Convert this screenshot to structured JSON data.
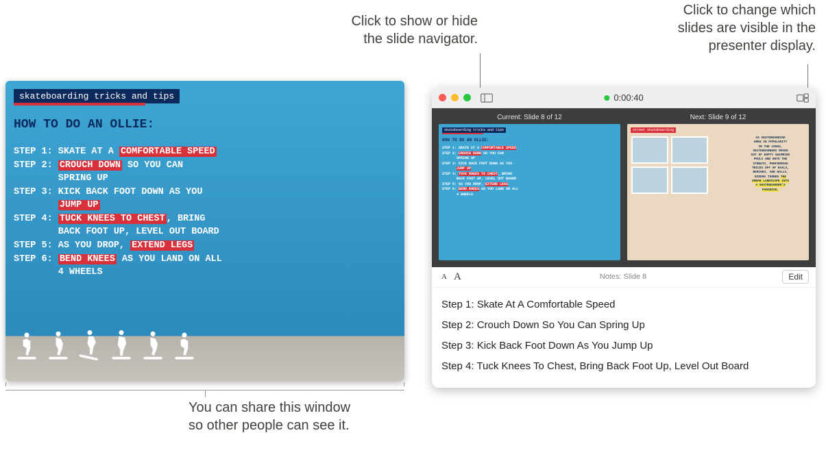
{
  "callouts": {
    "navigator": "Click to show or hide\nthe slide navigator.",
    "layout": "Click to change which\nslides are visible in the\npresenter display.",
    "share": "You can share this window\nso other people can see it."
  },
  "slide": {
    "topband": "skateboarding tricks and tips",
    "heading": "HOW TO DO AN OLLIE:",
    "steps_html": "STEP 1: SKATE AT A <span class='hl'>COMFORTABLE SPEED</span><br>STEP 2: <span class='hl'>CROUCH DOWN</span> SO YOU CAN<br>&nbsp;&nbsp;&nbsp;&nbsp;&nbsp;&nbsp;&nbsp;&nbsp;SPRING UP<br>STEP 3: KICK BACK FOOT DOWN AS YOU<br>&nbsp;&nbsp;&nbsp;&nbsp;&nbsp;&nbsp;&nbsp;&nbsp;<span class='hl'>JUMP UP</span><br>STEP 4: <span class='hl'>TUCK KNEES TO CHEST</span>, BRING<br>&nbsp;&nbsp;&nbsp;&nbsp;&nbsp;&nbsp;&nbsp;&nbsp;BACK FOOT UP, LEVEL OUT BOARD<br>STEP 5: AS YOU DROP, <span class='hl'>EXTEND LEGS</span><br>STEP 6: <span class='hl'>BEND KNEES</span> AS YOU LAND ON ALL<br>&nbsp;&nbsp;&nbsp;&nbsp;&nbsp;&nbsp;&nbsp;&nbsp;4 WHEELS"
  },
  "presenter": {
    "timer": "0:00:40",
    "current_label": "Current: Slide 8 of 12",
    "next_label": "Next: Slide 9 of 12",
    "thumb_current": {
      "topband": "skateboarding tricks and tips",
      "heading": "HOW TO DO AN OLLIE:",
      "steps_html": "STEP 1: SKATE AT A <span class='hl'>COMFORTABLE SPEED</span><br>STEP 2: <span class='hl'>CROUCH DOWN</span> SO YOU CAN<br>&nbsp;&nbsp;&nbsp;&nbsp;&nbsp;&nbsp;&nbsp;SPRING UP<br>STEP 3: KICK BACK FOOT DOWN AS YOU<br>&nbsp;&nbsp;&nbsp;&nbsp;&nbsp;&nbsp;&nbsp;<span class='hl'>JUMP UP</span><br>STEP 4: <span class='hl'>TUCK KNEES TO CHEST</span>, BRING<br>&nbsp;&nbsp;&nbsp;&nbsp;&nbsp;&nbsp;&nbsp;BACK FOOT UP, LEVEL OUT BOARD<br>STEP 5: AS YOU DROP, <span class='hl'>EXTEND LEGS</span><br>STEP 6: <span class='hl'>BEND KNEES</span> AS YOU LAND ON ALL<br>&nbsp;&nbsp;&nbsp;&nbsp;&nbsp;&nbsp;&nbsp;4 WHEELS"
    },
    "thumb_next": {
      "band": "street skateboarding",
      "text_html": "AS SKATEBOARDING<br>GREW IN POPULARITY<br>IN THE 1980S,<br>SKATEBOARDERS MOVED<br>OUT OF EMPTY SWIMMING<br>POOLS AND ONTO THE<br>STREETS, PERFORMING<br>TRICKS OFF OF RAILS,<br>BENCHES, AND WALLS,<br>RIDERS TURNED <span class='yh'>THE<br>URBAN LANDSCAPE INTO<br>A SKATEBOARDER'S<br>PARADISE.</span>"
    },
    "font_small": "A",
    "font_large": "A",
    "notes_title": "Notes: Slide 8",
    "edit_label": "Edit",
    "notes": [
      "Step 1: Skate At A Comfortable Speed",
      "Step 2: Crouch Down So You Can Spring Up",
      "Step 3: Kick Back Foot Down As You Jump Up",
      "Step 4: Tuck Knees To Chest, Bring Back Foot Up, Level Out Board"
    ]
  }
}
